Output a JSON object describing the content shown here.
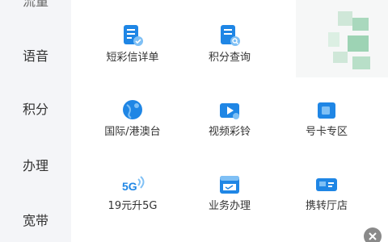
{
  "sidebar": {
    "items": [
      {
        "label": "流量"
      },
      {
        "label": "语音"
      },
      {
        "label": "积分"
      },
      {
        "label": "办理"
      },
      {
        "label": "宽带"
      }
    ]
  },
  "grid": {
    "row1": [
      {
        "label": "短彩信详单",
        "icon": "sms-detail-icon"
      },
      {
        "label": "积分查询",
        "icon": "points-query-icon"
      }
    ],
    "row2": [
      {
        "label": "国际/港澳台",
        "icon": "globe-icon"
      },
      {
        "label": "视频彩铃",
        "icon": "video-ringtone-icon"
      },
      {
        "label": "号卡专区",
        "icon": "sim-card-icon"
      }
    ],
    "row3": [
      {
        "label": "19元升5G",
        "icon": "5g-icon"
      },
      {
        "label": "业务办理",
        "icon": "calendar-icon"
      },
      {
        "label": "携转厅店",
        "icon": "card-transfer-icon"
      }
    ]
  },
  "colors": {
    "accent": "#1f86e5",
    "accent_light": "#7fc0f5"
  }
}
